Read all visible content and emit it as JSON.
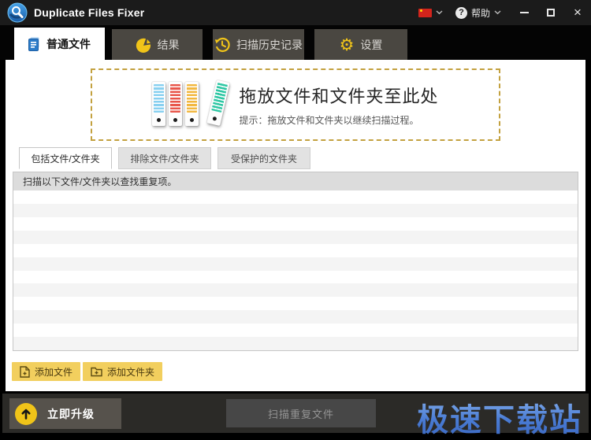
{
  "window": {
    "title": "Duplicate Files Fixer",
    "help_label": "帮助",
    "close_glyph": "×"
  },
  "tabs": [
    {
      "label": "普通文件",
      "icon": "document-icon",
      "active": true
    },
    {
      "label": "结果",
      "icon": "pie-chart-icon",
      "active": false
    },
    {
      "label": "扫描历史记录",
      "icon": "history-icon",
      "active": false
    },
    {
      "label": "设置",
      "icon": "gear-icon",
      "active": false
    }
  ],
  "dropzone": {
    "title": "拖放文件和文件夹至此处",
    "tip": "提示：拖放文件和文件夹以继续扫描过程。"
  },
  "subtabs": [
    {
      "label": "包括文件/文件夹",
      "active": true
    },
    {
      "label": "排除文件/文件夹",
      "active": false
    },
    {
      "label": "受保护的文件夹",
      "active": false
    }
  ],
  "list": {
    "header": "扫描以下文件/文件夹以查找重复项。",
    "row_count": 12
  },
  "buttons": {
    "add_file": "添加文件",
    "add_folder": "添加文件夹",
    "upgrade": "立即升级",
    "scan": "扫描重复文件"
  },
  "watermark": "极速下载站",
  "icons": {
    "gear_glyph": "⚙"
  },
  "colors": {
    "accent_yellow": "#F0C419",
    "button_yellow": "#F2CF5E",
    "titlebar": "#1B1B1B",
    "tab_inactive": "#4A4741",
    "bottombar": "#2B2A27",
    "dropzone_border": "#C3A13F",
    "list_header": "#DCDCDC",
    "row_alt": "#F4F4F4",
    "watermark_blue": "#4A7CD4",
    "logo_blue": "#2B7BC8",
    "flag_red": "#D2241C"
  }
}
